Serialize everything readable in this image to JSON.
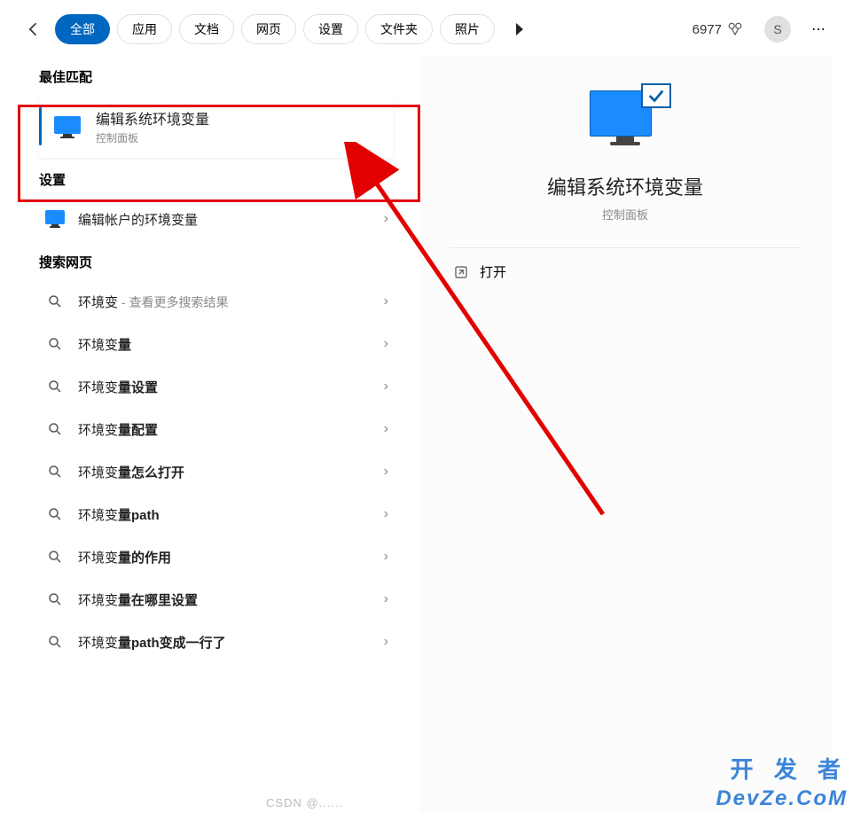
{
  "header": {
    "tabs": [
      "全部",
      "应用",
      "文档",
      "网页",
      "设置",
      "文件夹",
      "照片"
    ],
    "active_tab_index": 0,
    "points": "6977",
    "avatar_letter": "S"
  },
  "left": {
    "best_match_section": "最佳匹配",
    "best_match": {
      "title": "编辑系统环境变量",
      "subtitle": "控制面板"
    },
    "settings_section": "设置",
    "settings_items": [
      {
        "title": "编辑帐户的环境变量"
      }
    ],
    "web_section": "搜索网页",
    "web_items": [
      {
        "prefix": "环境变",
        "bold": "",
        "suffix": " - 查看更多搜索结果"
      },
      {
        "prefix": "环境变",
        "bold": "量",
        "suffix": ""
      },
      {
        "prefix": "环境变",
        "bold": "量设置",
        "suffix": ""
      },
      {
        "prefix": "环境变",
        "bold": "量配置",
        "suffix": ""
      },
      {
        "prefix": "环境变",
        "bold": "量怎么打开",
        "suffix": ""
      },
      {
        "prefix": "环境变",
        "bold": "量path",
        "suffix": ""
      },
      {
        "prefix": "环境变",
        "bold": "量的作用",
        "suffix": ""
      },
      {
        "prefix": "环境变",
        "bold": "量在哪里设置",
        "suffix": ""
      },
      {
        "prefix": "环境变",
        "bold": "量path变成一行了",
        "suffix": ""
      }
    ]
  },
  "right": {
    "title": "编辑系统环境变量",
    "subtitle": "控制面板",
    "open_label": "打开"
  },
  "watermarks": {
    "top": "开 发 者",
    "bottom": "DevZe.CoM",
    "csdn": "CSDN @......"
  }
}
